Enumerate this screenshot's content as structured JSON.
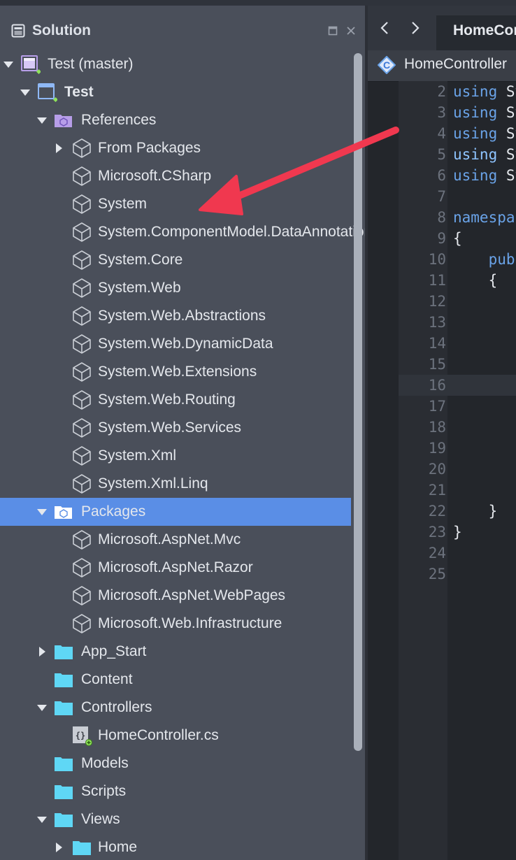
{
  "panel": {
    "title": "Solution",
    "buttons": {
      "restore_icon": "window-restore-icon",
      "close_icon": "close-icon"
    }
  },
  "tree": [
    {
      "label": "Test (master)",
      "type": "solution",
      "level": 0,
      "arrow": "down"
    },
    {
      "label": "Test",
      "type": "project",
      "level": 1,
      "arrow": "down",
      "bold": true
    },
    {
      "label": "References",
      "type": "ref-folder",
      "level": 2,
      "arrow": "down"
    },
    {
      "label": "From Packages",
      "type": "assembly",
      "level": 3,
      "arrow": "right"
    },
    {
      "label": "Microsoft.CSharp",
      "type": "assembly",
      "level": 3,
      "arrow": ""
    },
    {
      "label": "System",
      "type": "assembly",
      "level": 3,
      "arrow": ""
    },
    {
      "label": "System.ComponentModel.DataAnnotations",
      "type": "assembly",
      "level": 3,
      "arrow": ""
    },
    {
      "label": "System.Core",
      "type": "assembly",
      "level": 3,
      "arrow": ""
    },
    {
      "label": "System.Web",
      "type": "assembly",
      "level": 3,
      "arrow": ""
    },
    {
      "label": "System.Web.Abstractions",
      "type": "assembly",
      "level": 3,
      "arrow": ""
    },
    {
      "label": "System.Web.DynamicData",
      "type": "assembly",
      "level": 3,
      "arrow": ""
    },
    {
      "label": "System.Web.Extensions",
      "type": "assembly",
      "level": 3,
      "arrow": ""
    },
    {
      "label": "System.Web.Routing",
      "type": "assembly",
      "level": 3,
      "arrow": ""
    },
    {
      "label": "System.Web.Services",
      "type": "assembly",
      "level": 3,
      "arrow": ""
    },
    {
      "label": "System.Xml",
      "type": "assembly",
      "level": 3,
      "arrow": ""
    },
    {
      "label": "System.Xml.Linq",
      "type": "assembly",
      "level": 3,
      "arrow": ""
    },
    {
      "label": "Packages",
      "type": "pkg-folder",
      "level": 2,
      "arrow": "down",
      "selected": true
    },
    {
      "label": "Microsoft.AspNet.Mvc",
      "type": "assembly",
      "level": 3,
      "arrow": ""
    },
    {
      "label": "Microsoft.AspNet.Razor",
      "type": "assembly",
      "level": 3,
      "arrow": ""
    },
    {
      "label": "Microsoft.AspNet.WebPages",
      "type": "assembly",
      "level": 3,
      "arrow": ""
    },
    {
      "label": "Microsoft.Web.Infrastructure",
      "type": "assembly",
      "level": 3,
      "arrow": ""
    },
    {
      "label": "App_Start",
      "type": "folder",
      "level": 2,
      "arrow": "right"
    },
    {
      "label": "Content",
      "type": "folder",
      "level": 2,
      "arrow": ""
    },
    {
      "label": "Controllers",
      "type": "folder",
      "level": 2,
      "arrow": "down"
    },
    {
      "label": "HomeController.cs",
      "type": "csfile",
      "level": 3,
      "arrow": ""
    },
    {
      "label": "Models",
      "type": "folder",
      "level": 2,
      "arrow": ""
    },
    {
      "label": "Scripts",
      "type": "folder",
      "level": 2,
      "arrow": ""
    },
    {
      "label": "Views",
      "type": "folder",
      "level": 2,
      "arrow": "down"
    },
    {
      "label": "Home",
      "type": "folder",
      "level": 3,
      "arrow": "right"
    }
  ],
  "editor": {
    "nav_back_icon": "chevron-left-icon",
    "nav_forward_icon": "chevron-right-icon",
    "tab_title": "HomeController.cs",
    "breadcrumb": {
      "label": "HomeController",
      "icon_letter": "C"
    },
    "current_line": 16,
    "lines": [
      {
        "n": "2",
        "code": "using System;",
        "kw": "using"
      },
      {
        "n": "3",
        "code": "using System.Collections.Generic;",
        "kw": "using"
      },
      {
        "n": "4",
        "code": "using System.Linq;",
        "kw": "using"
      },
      {
        "n": "5",
        "code": "using System.Web;",
        "kw": "using",
        "strong": true
      },
      {
        "n": "6",
        "code": "using System.Web.Mvc;",
        "kw": "using"
      },
      {
        "n": "7",
        "code": ""
      },
      {
        "n": "8",
        "code": "namespace Test.Controllers",
        "kw": "namespace"
      },
      {
        "n": "9",
        "code": "{"
      },
      {
        "n": "10",
        "code": "    public class HomeController : Controller",
        "kw": "public"
      },
      {
        "n": "11",
        "code": "    {"
      },
      {
        "n": "12",
        "code": ""
      },
      {
        "n": "13",
        "code": ""
      },
      {
        "n": "14",
        "code": ""
      },
      {
        "n": "15",
        "code": ""
      },
      {
        "n": "16",
        "code": ""
      },
      {
        "n": "17",
        "code": ""
      },
      {
        "n": "18",
        "code": ""
      },
      {
        "n": "19",
        "code": ""
      },
      {
        "n": "20",
        "code": ""
      },
      {
        "n": "21",
        "code": ""
      },
      {
        "n": "22",
        "code": "    }"
      },
      {
        "n": "23",
        "code": "}"
      },
      {
        "n": "24",
        "code": ""
      },
      {
        "n": "25",
        "code": ""
      }
    ]
  },
  "annotation": {
    "arrow_color": "#f0384f",
    "icon": "annotation-arrow-icon"
  },
  "colors": {
    "selection": "#5a8ee6",
    "folder": "#5fd7f5",
    "ref_folder": "#b79ee8",
    "keyword": "#6aa3e8"
  }
}
